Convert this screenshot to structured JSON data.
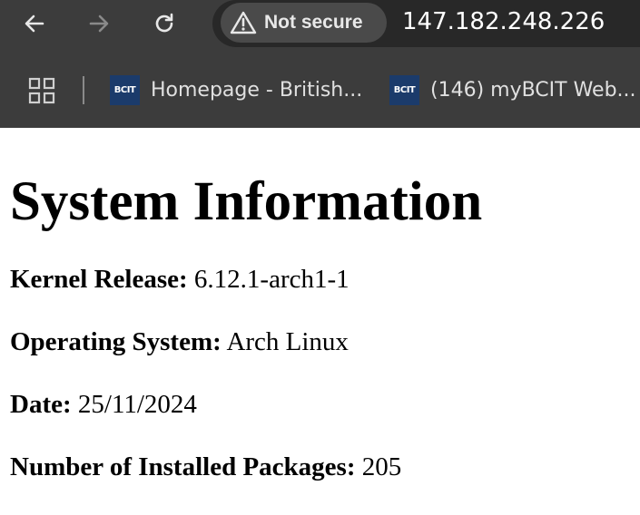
{
  "browser": {
    "security_label": "Not secure",
    "url": "147.182.248.226",
    "nav_icons": [
      "back-arrow-icon",
      "forward-arrow-icon",
      "reload-icon"
    ],
    "bookmarks": [
      {
        "favicon_text": "BCIT",
        "label": "Homepage - British..."
      },
      {
        "favicon_text": "BCIT",
        "label": "(146) myBCIT Web..."
      }
    ]
  },
  "page": {
    "title": "System Information",
    "rows": [
      {
        "key": "Kernel Release:",
        "value": "6.12.1-arch1-1"
      },
      {
        "key": "Operating System:",
        "value": "Arch Linux"
      },
      {
        "key": "Date:",
        "value": "25/11/2024"
      },
      {
        "key": "Number of Installed Packages:",
        "value": "205"
      }
    ]
  },
  "colors": {
    "chrome_bg": "#3c3c3c",
    "omnibox_bg": "#282828",
    "chip_bg": "#4a4a4a",
    "favicon_bg": "#1b3b6b"
  }
}
